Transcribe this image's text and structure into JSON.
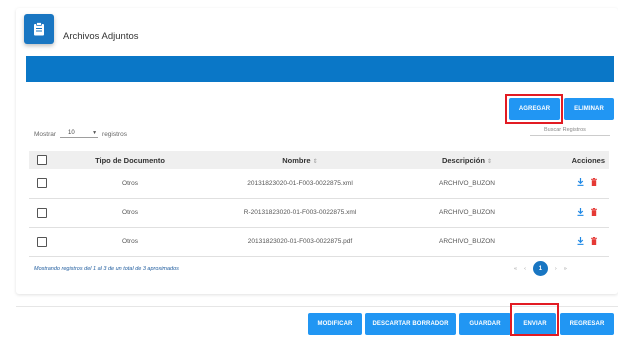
{
  "header": {
    "icon": "clipboard-icon",
    "title": "Archivos Adjuntos"
  },
  "toolbar": {
    "add_label": "AGREGAR",
    "delete_label": "ELIMINAR"
  },
  "length": {
    "prefix": "Mostrar",
    "value": "10",
    "suffix": "registros"
  },
  "search": {
    "placeholder": "Buscar Registros"
  },
  "table": {
    "headers": {
      "tipo": "Tipo de Documento",
      "nombre": "Nombre",
      "descripcion": "Descripción",
      "acciones": "Acciones"
    },
    "rows": [
      {
        "tipo": "Otros",
        "nombre": "20131823020-01-F003-0022875.xml",
        "descripcion": "ARCHIVO_BUZON"
      },
      {
        "tipo": "Otros",
        "nombre": "R-20131823020-01-F003-0022875.xml",
        "descripcion": "ARCHIVO_BUZON"
      },
      {
        "tipo": "Otros",
        "nombre": "20131823020-01-F003-0022875.pdf",
        "descripcion": "ARCHIVO_BUZON"
      }
    ]
  },
  "footer": {
    "info": "Mostrando registros del 1 al 3 de un total de 3 aproximados"
  },
  "pagination": {
    "first": "«",
    "prev": "‹",
    "current": "1",
    "next": "›",
    "last": "»"
  },
  "actions": {
    "modificar": "MODIFICAR",
    "descartar": "DESCARTAR BORRADOR",
    "guardar": "GUARDAR",
    "enviar": "ENVIAR",
    "regresar": "REGRESAR"
  },
  "colors": {
    "primary": "#2196f3",
    "header_bar": "#0a77c7",
    "highlight": "#e21b23",
    "download_icon": "#1e88e5",
    "delete_icon": "#e53935"
  }
}
